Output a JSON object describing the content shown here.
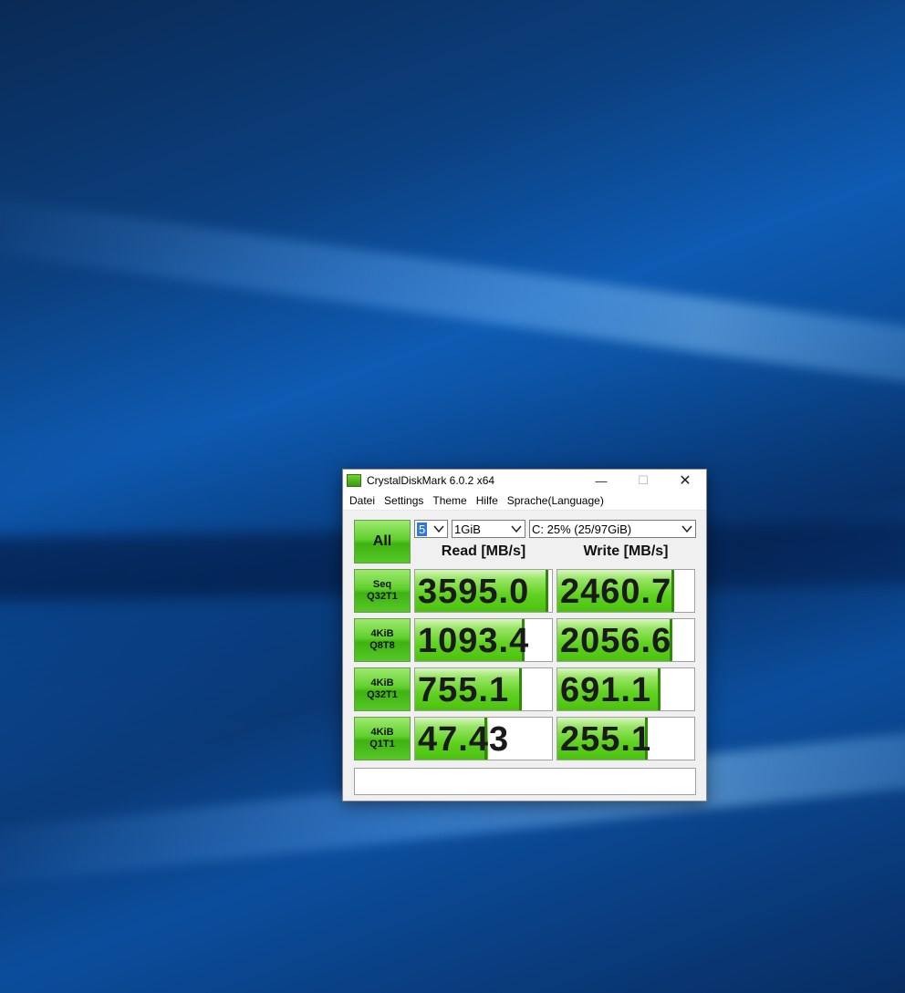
{
  "window": {
    "title": "CrystalDiskMark 6.0.2 x64",
    "minimize": "—",
    "maximize": "☐",
    "close": "✕"
  },
  "menu": [
    "Datei",
    "Settings",
    "Theme",
    "Hilfe",
    "Sprache(Language)"
  ],
  "controls": {
    "all_label": "All",
    "count": "5",
    "size": "1GiB",
    "drive": "C: 25% (25/97GiB)"
  },
  "headers": {
    "read": "Read [MB/s]",
    "write": "Write [MB/s]"
  },
  "tests": [
    {
      "line1": "Seq",
      "line2": "Q32T1",
      "read": "3595.0",
      "write": "2460.7",
      "read_fill": 0.97,
      "write_fill": 0.85
    },
    {
      "line1": "4KiB",
      "line2": "Q8T8",
      "read": "1093.4",
      "write": "2056.6",
      "read_fill": 0.8,
      "write_fill": 0.84
    },
    {
      "line1": "4KiB",
      "line2": "Q32T1",
      "read": "755.1",
      "write": "691.1",
      "read_fill": 0.78,
      "write_fill": 0.75
    },
    {
      "line1": "4KiB",
      "line2": "Q1T1",
      "read": "47.43",
      "write": "255.1",
      "read_fill": 0.53,
      "write_fill": 0.66
    }
  ],
  "status": ""
}
